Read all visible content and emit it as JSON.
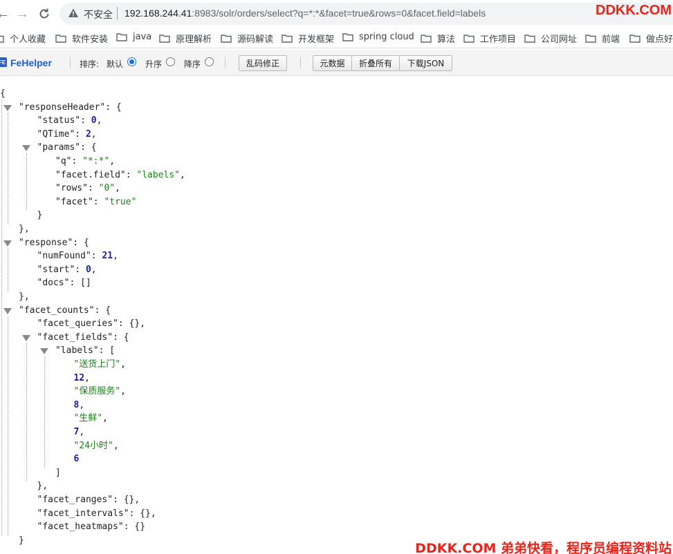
{
  "browser": {
    "security_label": "不安全",
    "url_host": "192.168.244.41",
    "url_rest": ":8983/solr/orders/select?q=*:*&facet=true&rows=0&facet.field=labels",
    "watermark": "DDKK.COM"
  },
  "bookmarks": [
    {
      "label": "个人收藏"
    },
    {
      "label": "软件安装"
    },
    {
      "label": "java"
    },
    {
      "label": "原理解析"
    },
    {
      "label": "源码解读"
    },
    {
      "label": "开发框架"
    },
    {
      "label": "spring cloud"
    },
    {
      "label": "算法"
    },
    {
      "label": "工作项目"
    },
    {
      "label": "公司网址"
    },
    {
      "label": "前端"
    },
    {
      "label": "做点好玩"
    }
  ],
  "fehelper": {
    "logo_text": "FE",
    "name": "FeHelper",
    "sort_label": "排序:",
    "sort_options": [
      {
        "label": "默认",
        "selected": true
      },
      {
        "label": "升序",
        "selected": false
      },
      {
        "label": "降序",
        "selected": false
      }
    ],
    "fix_encoding_button": "乱码修正",
    "raw_button": "元数据",
    "collapse_button": "折叠所有",
    "download_button": "下载JSON"
  },
  "json_lines": [
    {
      "kind": "open_brace"
    },
    {
      "kind": "key_open",
      "key": "responseHeader",
      "bracket": "{"
    },
    {
      "key": "status",
      "value": "0",
      "type": "number",
      "comma": true
    },
    {
      "key": "QTime",
      "value": "2",
      "type": "number",
      "comma": true
    },
    {
      "kind": "key_open",
      "key": "params",
      "bracket": "{"
    },
    {
      "key": "q",
      "value": "\"*:*\"",
      "type": "string",
      "comma": true
    },
    {
      "key": "facet.field",
      "value": "\"labels\"",
      "type": "string",
      "comma": true
    },
    {
      "key": "rows",
      "value": "\"0\"",
      "type": "string",
      "comma": true
    },
    {
      "key": "facet",
      "value": "\"true\"",
      "type": "string",
      "comma": false
    },
    {
      "kind": "close",
      "text": "}"
    },
    {
      "kind": "close",
      "text": "},"
    },
    {
      "kind": "key_open",
      "key": "response",
      "bracket": "{"
    },
    {
      "key": "numFound",
      "value": "21",
      "type": "number",
      "comma": true
    },
    {
      "key": "start",
      "value": "0",
      "type": "number",
      "comma": true
    },
    {
      "key": "docs",
      "value": "[]",
      "type": "plain",
      "comma": false
    },
    {
      "kind": "close",
      "text": "},"
    },
    {
      "kind": "key_open",
      "key": "facet_counts",
      "bracket": "{"
    },
    {
      "key": "facet_queries",
      "value": "{}",
      "type": "plain",
      "comma": true
    },
    {
      "kind": "key_open",
      "key": "facet_fields",
      "bracket": "{"
    },
    {
      "kind": "key_open",
      "key": "labels",
      "bracket": "["
    },
    {
      "value": "\"送货上门\"",
      "type": "string",
      "comma": true
    },
    {
      "value": "12",
      "type": "number",
      "comma": true
    },
    {
      "value": "\"保质服务\"",
      "type": "string",
      "comma": true
    },
    {
      "value": "8",
      "type": "number",
      "comma": true
    },
    {
      "value": "\"生鲜\"",
      "type": "string",
      "comma": true
    },
    {
      "value": "7",
      "type": "number",
      "comma": true
    },
    {
      "value": "\"24小时\"",
      "type": "string",
      "comma": true
    },
    {
      "value": "6",
      "type": "number",
      "comma": false
    },
    {
      "kind": "close",
      "text": "]"
    },
    {
      "kind": "close",
      "text": "},"
    },
    {
      "key": "facet_ranges",
      "value": "{}",
      "type": "plain",
      "comma": true
    },
    {
      "key": "facet_intervals",
      "value": "{}",
      "type": "plain",
      "comma": true
    },
    {
      "key": "facet_heatmaps",
      "value": "{}",
      "type": "plain",
      "comma": false
    },
    {
      "kind": "close",
      "text": "}"
    }
  ],
  "watermark_bottom": "DDKK.COM 弟弟快看，程序员编程资料站",
  "colors": {
    "string": "#1a7f1a",
    "number": "#1a1aa6",
    "watermark": "#e8241b"
  }
}
